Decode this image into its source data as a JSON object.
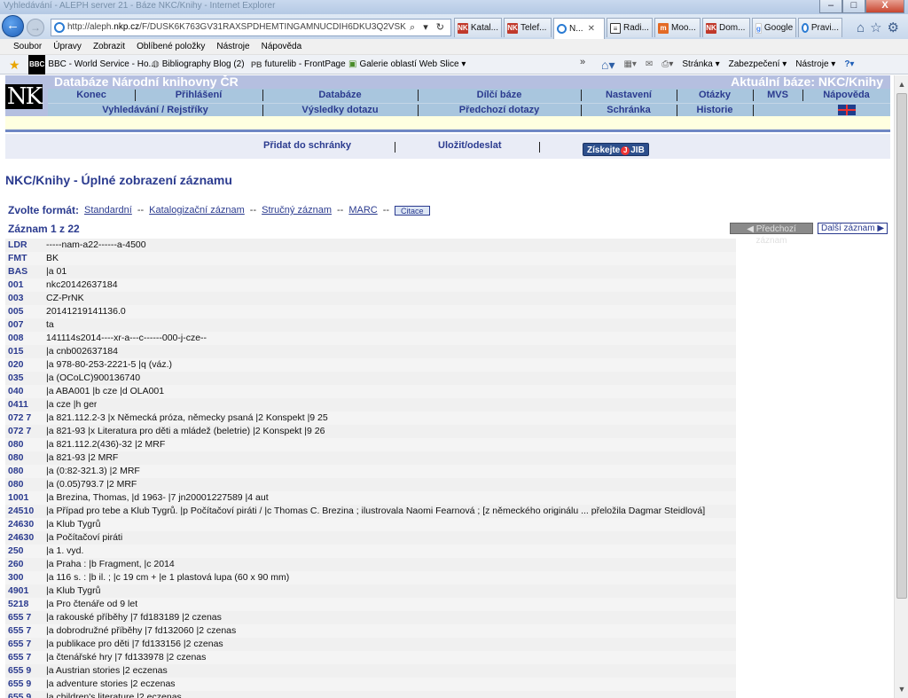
{
  "window": {
    "titlebar_text": "Vyhledávání - ALEPH server 21 - Báze NKC/Knihy - Internet Explorer",
    "min": "–",
    "max": "□",
    "close": "X"
  },
  "address": {
    "prefix": "http://aleph.",
    "domain": "nkp.cz",
    "rest": "/F/DUSK6K763GV31RAXSPDHEMTINGAMNUCDIH6DKU3Q2VSKSJTRS9-16",
    "tools": "⌕ ▾ ↻"
  },
  "tabs": [
    {
      "label": "Katal...",
      "icon": "nk",
      "active": false
    },
    {
      "label": "Telef...",
      "icon": "nk",
      "active": false
    },
    {
      "label": "N...",
      "icon": "ie",
      "active": true
    },
    {
      "label": "Radi...",
      "icon": "doc",
      "active": false
    },
    {
      "label": "Moo...",
      "icon": "moo",
      "active": false
    },
    {
      "label": "Dom...",
      "icon": "nk",
      "active": false
    },
    {
      "label": "Google",
      "icon": "g",
      "active": false
    },
    {
      "label": "Pravi...",
      "icon": "ie",
      "active": false
    }
  ],
  "menubar": [
    "Soubor",
    "Úpravy",
    "Zobrazit",
    "Oblíbené položky",
    "Nástroje",
    "Nápověda"
  ],
  "favorites": [
    {
      "label": "BBC - World Service - Ho..."
    },
    {
      "label": "Bibliography Blog (2)"
    },
    {
      "label": "futurelib - FrontPage"
    },
    {
      "label": "Galerie oblastí Web Slice ▾"
    }
  ],
  "commands": [
    "Stránka ▾",
    "Zabezpečení ▾",
    "Nástroje ▾"
  ],
  "nk": {
    "logo": "NK",
    "title": "Databáze Národní knihovny ČR",
    "current_base": "Aktuální báze:  NKC/Knihy",
    "menu1": [
      "Konec",
      "Přihlášení",
      "Databáze",
      "Dílčí báze",
      "Nastavení",
      "Otázky",
      "MVS",
      "Nápověda"
    ],
    "menu2": [
      "Vyhledávání / Rejstříky",
      "Výsledky dotazu",
      "Předchozí dotazy",
      "Schránka",
      "Historie"
    ],
    "actions": [
      "Přidat do schránky",
      "Uložit/odeslat"
    ],
    "jib_label_pre": "Získejte",
    "jib_label_post": "JIB"
  },
  "page": {
    "title": "NKC/Knihy - Úplné zobrazení záznamu",
    "format_label": "Zvolte formát:",
    "formats": [
      "Standardní",
      "Katalogizační záznam",
      "Stručný záznam",
      "MARC"
    ],
    "citation_button": "Citace",
    "record_counter": "Záznam 1 z 22",
    "prev_button": "◀ Předchozí záznam",
    "next_button": "Další záznam ▶"
  },
  "marc": [
    {
      "tag": "LDR",
      "value": "-----nam-a22------a-4500"
    },
    {
      "tag": "FMT",
      "value": "BK"
    },
    {
      "tag": "BAS",
      "value": "|a 01"
    },
    {
      "tag": "001",
      "value": "nkc20142637184"
    },
    {
      "tag": "003",
      "value": "CZ-PrNK"
    },
    {
      "tag": "005",
      "value": "20141219141136.0"
    },
    {
      "tag": "007",
      "value": "ta"
    },
    {
      "tag": "008",
      "value": "141114s2014----xr-a---c------000-j-cze--"
    },
    {
      "tag": "015",
      "value": "|a cnb002637184"
    },
    {
      "tag": "020",
      "value": "|a 978-80-253-2221-5 |q (váz.)"
    },
    {
      "tag": "035",
      "value": "|a (OCoLC)900136740"
    },
    {
      "tag": "040",
      "value": "|a ABA001 |b cze |d OLA001"
    },
    {
      "tag": "0411",
      "value": "|a cze |h ger"
    },
    {
      "tag": "072 7",
      "value": "|a 821.112.2-3 |x Německá próza, německy psaná |2 Konspekt |9 25"
    },
    {
      "tag": "072 7",
      "value": "|a 821-93 |x Literatura pro děti a mládež (beletrie) |2 Konspekt |9 26"
    },
    {
      "tag": "080",
      "value": "|a 821.112.2(436)-32 |2 MRF"
    },
    {
      "tag": "080",
      "value": "|a 821-93 |2 MRF"
    },
    {
      "tag": "080",
      "value": "|a (0:82-321.3) |2 MRF"
    },
    {
      "tag": "080",
      "value": "|a (0.05)793.7 |2 MRF"
    },
    {
      "tag": "1001",
      "value": "|a Brezina, Thomas, |d 1963- |7 jn20001227589 |4 aut"
    },
    {
      "tag": "24510",
      "value": "|a Případ pro tebe a Klub Tygrů. |p Počítačoví piráti / |c Thomas C. Brezina ; ilustrovala Naomi Fearnová ; [z německého originálu ... přeložila Dagmar Steidlová]"
    },
    {
      "tag": "24630",
      "value": "|a Klub Tygrů"
    },
    {
      "tag": "24630",
      "value": "|a Počítačoví piráti"
    },
    {
      "tag": "250",
      "value": "|a 1. vyd."
    },
    {
      "tag": "260",
      "value": "|a Praha : |b Fragment, |c 2014"
    },
    {
      "tag": "300",
      "value": "|a 116 s. : |b il. ; |c 19 cm + |e 1 plastová lupa (60 x 90 mm)"
    },
    {
      "tag": "4901",
      "value": "|a Klub Tygrů"
    },
    {
      "tag": "5218",
      "value": "|a Pro čtenáře od 9 let"
    },
    {
      "tag": "655 7",
      "value": "|a rakouské příběhy |7 fd183189 |2 czenas"
    },
    {
      "tag": "655 7",
      "value": "|a dobrodružné příběhy |7 fd132060 |2 czenas"
    },
    {
      "tag": "655 7",
      "value": "|a publikace pro děti |7 fd133156 |2 czenas"
    },
    {
      "tag": "655 7",
      "value": "|a čtenářské hry |7 fd133978 |2 czenas"
    },
    {
      "tag": "655 9",
      "value": "|a Austrian stories |2 eczenas"
    },
    {
      "tag": "655 9",
      "value": "|a adventure stories |2 eczenas"
    },
    {
      "tag": "655 9",
      "value": "|a children's literature |2 eczenas"
    }
  ]
}
